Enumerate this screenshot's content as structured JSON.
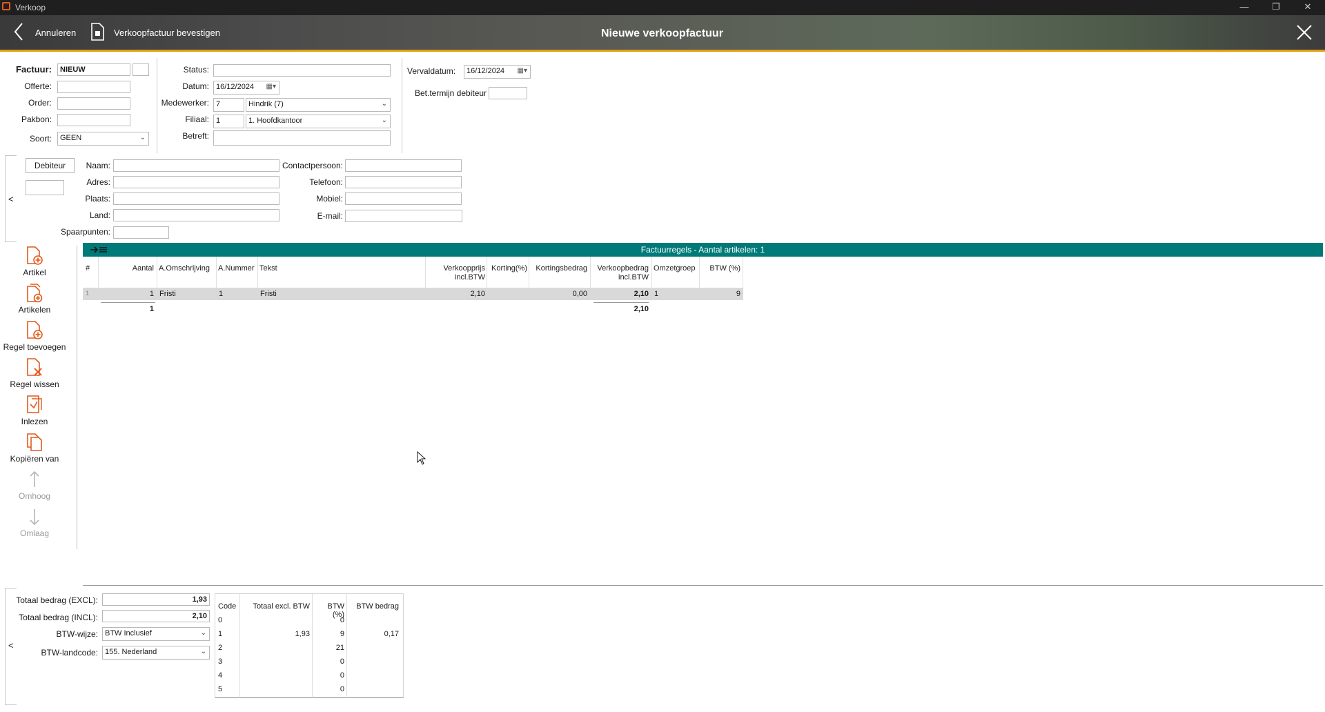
{
  "window": {
    "title": "Verkoop"
  },
  "header": {
    "cancel_label": "Annuleren",
    "confirm_label": "Verkoopfactuur bevestigen",
    "title": "Nieuwe verkoopfactuur"
  },
  "invoice": {
    "factuur_label": "Factuur:",
    "factuur_value": "NIEUW",
    "offerte_label": "Offerte:",
    "order_label": "Order:",
    "pakbon_label": "Pakbon:",
    "soort_label": "Soort:",
    "soort_value": "GEEN",
    "status_label": "Status:",
    "datum_label": "Datum:",
    "datum_value": "16/12/2024",
    "medewerker_label": "Medewerker:",
    "medewerker_code": "7",
    "medewerker_name": "Hindrik (7)",
    "filiaal_label": "Filiaal:",
    "filiaal_code": "1",
    "filiaal_name": "1. Hoofdkantoor",
    "betreft_label": "Betreft:",
    "vervaldatum_label": "Vervaldatum:",
    "vervaldatum_value": "16/12/2024",
    "bettermijn_label": "Bet.termijn debiteur"
  },
  "debtor": {
    "collapse_label": "<",
    "debiteur_button": "Debiteur",
    "naam_label": "Naam:",
    "adres_label": "Adres:",
    "plaats_label": "Plaats:",
    "land_label": "Land:",
    "spaarpunten_label": "Spaarpunten:",
    "contactpersoon_label": "Contactpersoon:",
    "telefoon_label": "Telefoon:",
    "mobiel_label": "Mobiel:",
    "email_label": "E-mail:"
  },
  "toolbar": {
    "artikel": "Artikel",
    "artikelen": "Artikelen",
    "regel_toevoegen": "Regel toevoegen",
    "regel_wissen": "Regel wissen",
    "inlezen": "Inlezen",
    "kopieren_van": "Kopiëren van",
    "omhoog": "Omhoog",
    "omlaag": "Omlaag"
  },
  "grid": {
    "title": "Factuurregels - Aantal artikelen: 1",
    "columns": {
      "nr": "#",
      "aantal": "Aantal",
      "omschrijving": "A.Omschrijving",
      "nummer": "A.Nummer",
      "tekst": "Tekst",
      "verkoopprijs_1": "Verkoopprijs",
      "verkoopprijs_2": "incl.BTW",
      "korting": "Korting(%)",
      "kortingsbedrag": "Kortingsbedrag",
      "verkoopbedrag_1": "Verkoopbedrag",
      "verkoopbedrag_2": "incl.BTW",
      "omzetgroep": "Omzetgroep",
      "btw": "BTW (%)"
    },
    "rows": [
      {
        "nr": "1",
        "aantal": "1",
        "omschrijving": "Fristi",
        "nummer": "1",
        "tekst": "Fristi",
        "verkoopprijs": "2,10",
        "korting": "",
        "kortingsbedrag": "0,00",
        "verkoopbedrag": "2,10",
        "omzetgroep": "1",
        "btw": "9"
      }
    ],
    "totals": {
      "aantal": "1",
      "verkoopbedrag": "2,10"
    }
  },
  "summary": {
    "collapse_label": "<",
    "excl_label": "Totaal bedrag (EXCL):",
    "excl_value": "1,93",
    "incl_label": "Totaal bedrag (INCL):",
    "incl_value": "2,10",
    "btw_wijze_label": "BTW-wijze:",
    "btw_wijze_value": "BTW Inclusief",
    "landcode_label": "BTW-landcode:",
    "landcode_value": "155. Nederland"
  },
  "btw_table": {
    "headers": {
      "code": "Code",
      "excl": "Totaal excl. BTW",
      "pct": "BTW (%)",
      "bedrag": "BTW bedrag"
    },
    "rows": [
      {
        "code": "0",
        "excl": "",
        "pct": "0",
        "bedrag": ""
      },
      {
        "code": "1",
        "excl": "1,93",
        "pct": "9",
        "bedrag": "0,17"
      },
      {
        "code": "2",
        "excl": "",
        "pct": "21",
        "bedrag": ""
      },
      {
        "code": "3",
        "excl": "",
        "pct": "0",
        "bedrag": ""
      },
      {
        "code": "4",
        "excl": "",
        "pct": "0",
        "bedrag": ""
      },
      {
        "code": "5",
        "excl": "",
        "pct": "0",
        "bedrag": ""
      }
    ]
  },
  "colors": {
    "accent_orange": "#e25a1c",
    "header_underline": "#e2a014",
    "grid_header": "#007a78"
  }
}
